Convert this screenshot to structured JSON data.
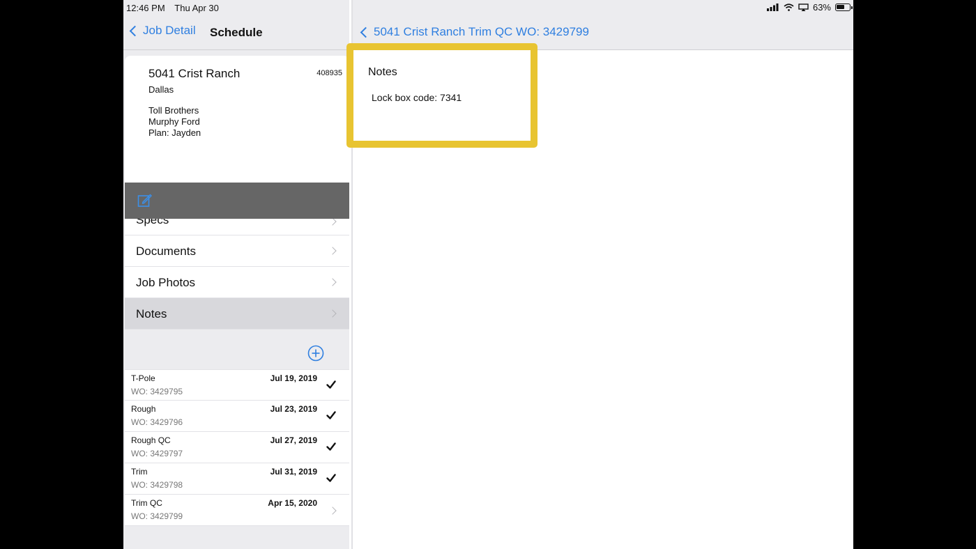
{
  "status_bar": {
    "time": "12:46 PM",
    "date": "Thu Apr 30",
    "battery": "63%",
    "battery_level": 0.63
  },
  "left_nav": {
    "back_label": "Job Detail",
    "title": "Schedule"
  },
  "job": {
    "address": "5041 Crist Ranch",
    "number": "408935",
    "city": "Dallas",
    "builder": "Toll Brothers",
    "contact": "Murphy Ford",
    "plan": "Plan: Jayden"
  },
  "menu": {
    "items": [
      {
        "label": "Specs"
      },
      {
        "label": "Documents"
      },
      {
        "label": "Job Photos"
      },
      {
        "label": "Notes"
      }
    ]
  },
  "schedule": [
    {
      "name": "T-Pole",
      "wo": "WO: 3429795",
      "date": "Jul 19, 2019",
      "status": "check"
    },
    {
      "name": "Rough",
      "wo": "WO: 3429796",
      "date": "Jul 23, 2019",
      "status": "check"
    },
    {
      "name": "Rough QC",
      "wo": "WO: 3429797",
      "date": "Jul 27, 2019",
      "status": "check"
    },
    {
      "name": "Trim",
      "wo": "WO: 3429798",
      "date": "Jul 31, 2019",
      "status": "check"
    },
    {
      "name": "Trim QC",
      "wo": "WO: 3429799",
      "date": "Apr 15, 2020",
      "status": "chevron"
    }
  ],
  "right_nav": {
    "back_label": "5041 Crist Ranch Trim QC WO: 3429799"
  },
  "notes": {
    "title": "Notes",
    "text": "Lock box code: 7341"
  },
  "colors": {
    "accent": "#2f7fe0",
    "highlight_border": "#e8c431",
    "action_bar": "#666666"
  }
}
